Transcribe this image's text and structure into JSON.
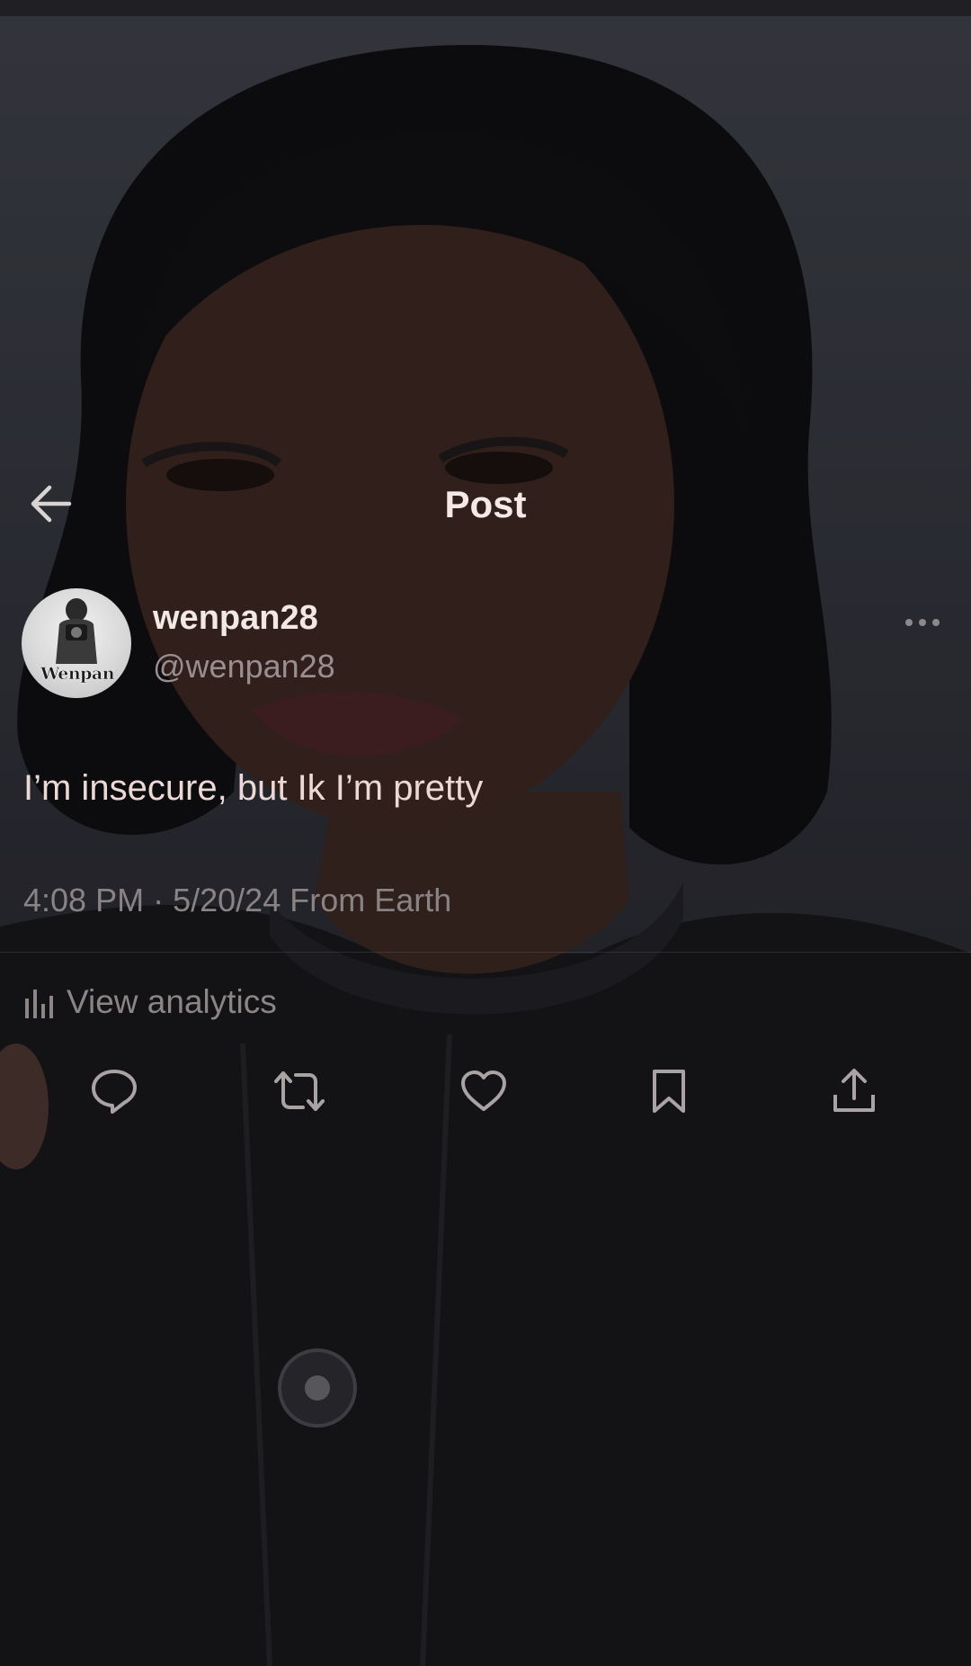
{
  "header": {
    "title": "Post",
    "back_icon": "arrow-left-icon"
  },
  "author": {
    "display_name": "wenpan28",
    "handle": "@wenpan28",
    "avatar_watermark": "Wenpan",
    "more_icon": "more-horizontal-icon"
  },
  "post": {
    "text": "I’m insecure, but Ik I’m pretty",
    "time": "4:08 PM",
    "separator": "·",
    "date": "5/20/24",
    "source": "From Earth"
  },
  "analytics": {
    "label": "View analytics",
    "icon": "analytics-bars-icon"
  },
  "actions": [
    {
      "name": "reply",
      "icon": "reply-icon"
    },
    {
      "name": "repost",
      "icon": "repost-icon"
    },
    {
      "name": "like",
      "icon": "heart-icon"
    },
    {
      "name": "bookmark",
      "icon": "bookmark-icon"
    },
    {
      "name": "share",
      "icon": "share-icon"
    }
  ],
  "colors": {
    "title": "#f5e9e6",
    "display_name": "#f2e8e4",
    "secondary_text": "#8a8384",
    "icon": "#a9a3a4"
  }
}
